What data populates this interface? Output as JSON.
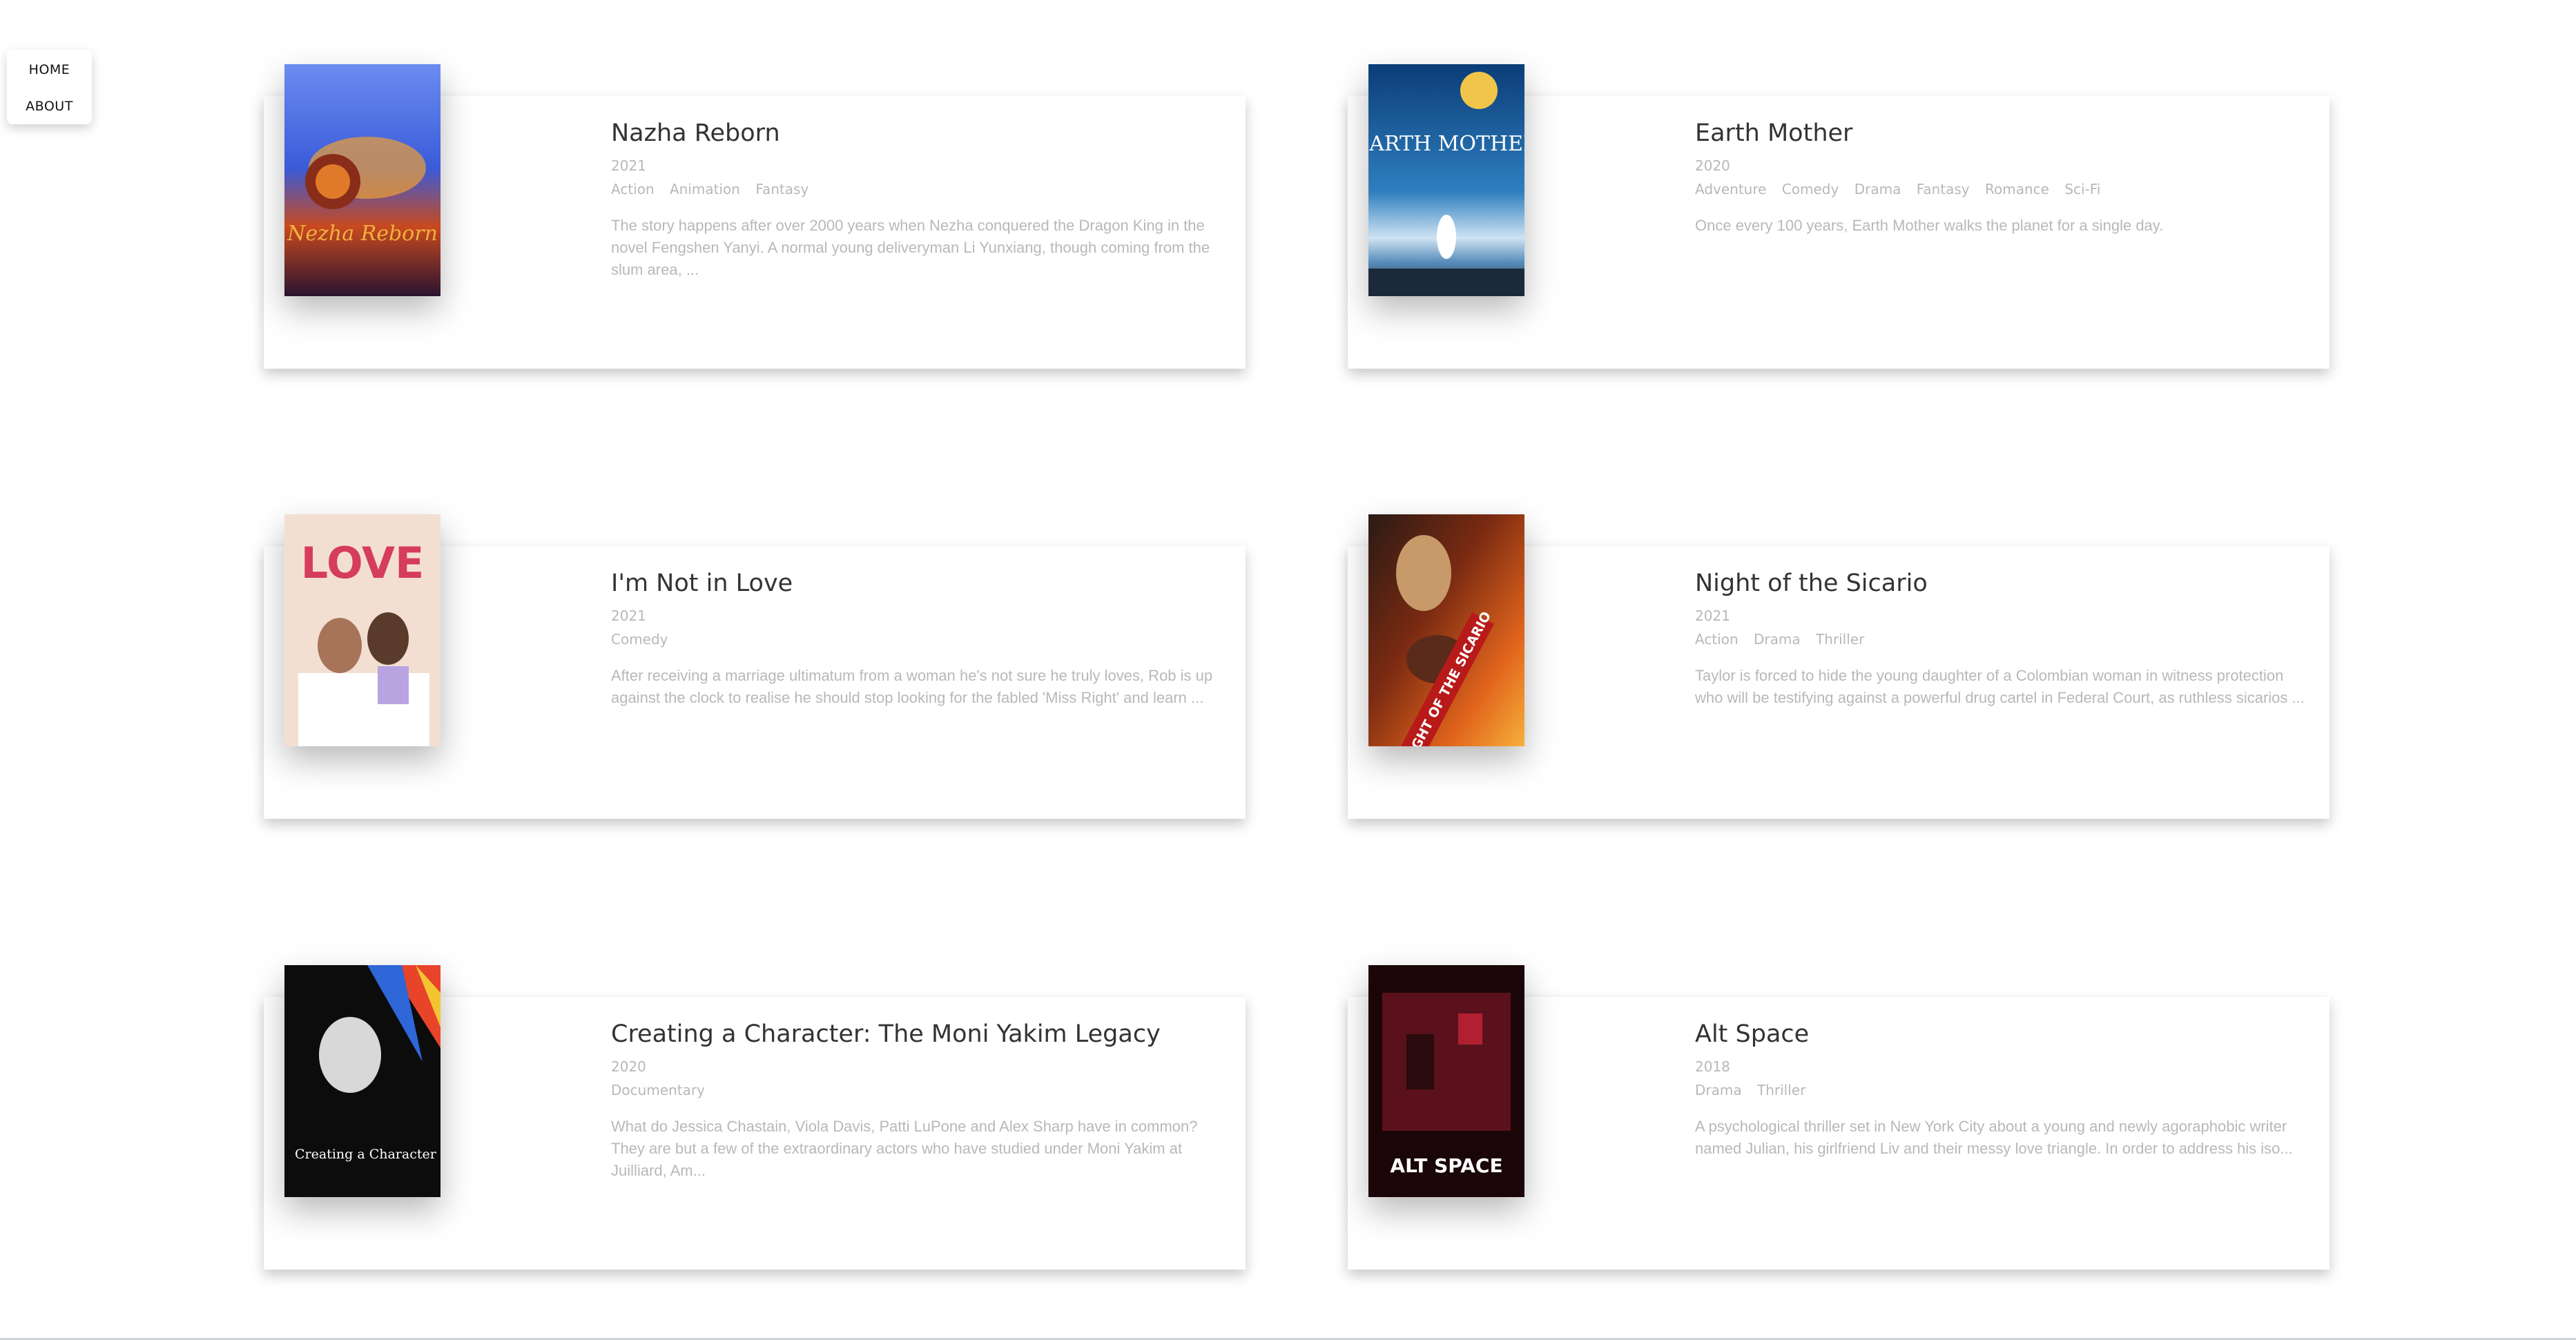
{
  "nav": {
    "home": "HOME",
    "about": "ABOUT"
  },
  "movies": [
    {
      "title": "Nazha Reborn",
      "year": "2021",
      "genres": [
        "Action",
        "Animation",
        "Fantasy"
      ],
      "overview": "The story happens after over 2000 years when Nezha conquered the Dragon King in the novel Fengshen Yanyi. A normal young deliveryman Li Yunxiang, though coming from the slum area, ...",
      "poster_text": "Nezha Reborn",
      "poster_colors": [
        "#3a5bd8",
        "#c8491e",
        "#f0a034"
      ]
    },
    {
      "title": "Earth Mother",
      "year": "2020",
      "genres": [
        "Adventure",
        "Comedy",
        "Drama",
        "Fantasy",
        "Romance",
        "Sci-Fi"
      ],
      "overview": "Once every 100 years, Earth Mother walks the planet for a single day.",
      "poster_text": "EARTH MOTHER",
      "poster_colors": [
        "#0b3d78",
        "#2f7fbf",
        "#cfe3f3"
      ]
    },
    {
      "title": "I'm Not in Love",
      "year": "2021",
      "genres": [
        "Comedy"
      ],
      "overview": "After receiving a marriage ultimatum from a woman he's not sure he truly loves, Rob is up against the clock to realise he should stop looking for the fabled 'Miss Right' and learn ...",
      "poster_text": "LOVE",
      "poster_colors": [
        "#f3dfd2",
        "#d63c5c",
        "#a7745a"
      ]
    },
    {
      "title": "Night of the Sicario",
      "year": "2021",
      "genres": [
        "Action",
        "Drama",
        "Thriller"
      ],
      "overview": "Taylor is forced to hide the young daughter of a Colombian woman in witness protection who will be testifying against a powerful drug cartel in Federal Court, as ruthless sicarios ...",
      "poster_text": "NIGHT OF THE SICARIO",
      "poster_colors": [
        "#7a2a12",
        "#e0641c",
        "#2a1a14"
      ]
    },
    {
      "title": "Creating a Character: The Moni Yakim Legacy",
      "year": "2020",
      "genres": [
        "Documentary"
      ],
      "overview": "What do Jessica Chastain, Viola Davis, Patti LuPone and Alex Sharp have in common? They are but a few of the extraordinary actors who have studied under Moni Yakim at Juilliard, Am...",
      "poster_text": "Creating a Character",
      "poster_colors": [
        "#0c0c0c",
        "#e8442a",
        "#2f66d8"
      ]
    },
    {
      "title": "Alt Space",
      "year": "2018",
      "genres": [
        "Drama",
        "Thriller"
      ],
      "overview": "A psychological thriller set in New York City about a young and newly agoraphobic writer named Julian, his girlfriend Liv and their messy love triangle. In order to address his iso...",
      "poster_text": "ALT SPACE",
      "poster_colors": [
        "#1a0608",
        "#6b1420",
        "#b02030"
      ]
    }
  ]
}
